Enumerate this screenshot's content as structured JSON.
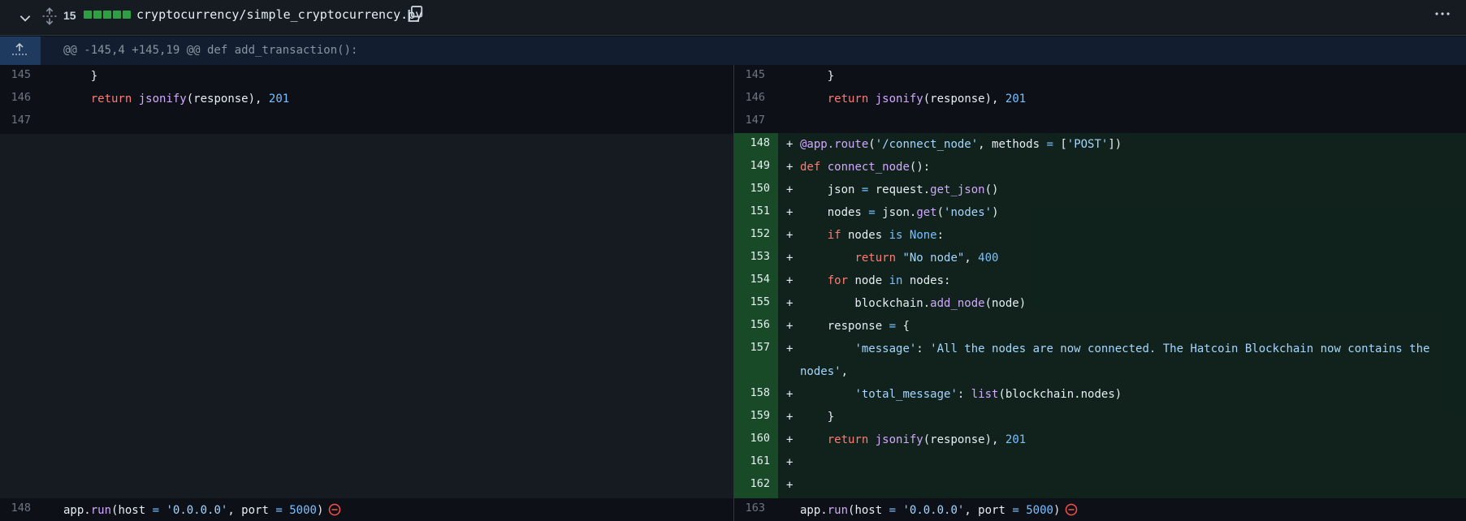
{
  "header": {
    "changes_count": "15",
    "filename": "cryptocurrency/simple_cryptocurrency.py"
  },
  "hunk": {
    "header": "@@ -145,4 +145,19 @@ def add_transaction():"
  },
  "left": {
    "lines": [
      {
        "num": "145",
        "code": "    }"
      },
      {
        "num": "146",
        "code": "    return jsonify(response), 201"
      },
      {
        "num": "147",
        "code": ""
      },
      {
        "num": "148",
        "code": "app.run(host = '0.0.0.0', port = 5000)"
      }
    ]
  },
  "right": {
    "lines": [
      {
        "num": "145",
        "code": "    }"
      },
      {
        "num": "146",
        "code": "    return jsonify(response), 201"
      },
      {
        "num": "147",
        "code": ""
      },
      {
        "num": "148",
        "code": "@app.route('/connect_node', methods = ['POST'])"
      },
      {
        "num": "149",
        "code": "def connect_node():"
      },
      {
        "num": "150",
        "code": "    json = request.get_json()"
      },
      {
        "num": "151",
        "code": "    nodes = json.get('nodes')"
      },
      {
        "num": "152",
        "code": "    if nodes is None:"
      },
      {
        "num": "153",
        "code": "        return \"No node\", 400"
      },
      {
        "num": "154",
        "code": "    for node in nodes:"
      },
      {
        "num": "155",
        "code": "        blockchain.add_node(node)"
      },
      {
        "num": "156",
        "code": "    response = {"
      },
      {
        "num": "157",
        "code": "        'message': 'All the nodes are now connected. The Hatcoin Blockchain now contains the",
        "cont": "nodes',"
      },
      {
        "num": "158",
        "code": "        'total_message': list(blockchain.nodes)"
      },
      {
        "num": "159",
        "code": "    }"
      },
      {
        "num": "160",
        "code": "    return jsonify(response), 201"
      },
      {
        "num": "161",
        "code": ""
      },
      {
        "num": "162",
        "code": ""
      },
      {
        "num": "163",
        "code": "app.run(host = '0.0.0.0', port = 5000)"
      }
    ]
  },
  "colors": {
    "added_gutter": "#2ea043",
    "added_line": "#238636",
    "hunk_bg": "#121d2f",
    "keyword": "#ff7b72",
    "string": "#a5d6ff",
    "number": "#79c0ff",
    "function": "#d2a8ff"
  },
  "icons": [
    "chevron-down-icon",
    "expand-icon",
    "copy-icon",
    "kebab-menu-icon",
    "expand-up-icon",
    "no-newline-icon"
  ]
}
